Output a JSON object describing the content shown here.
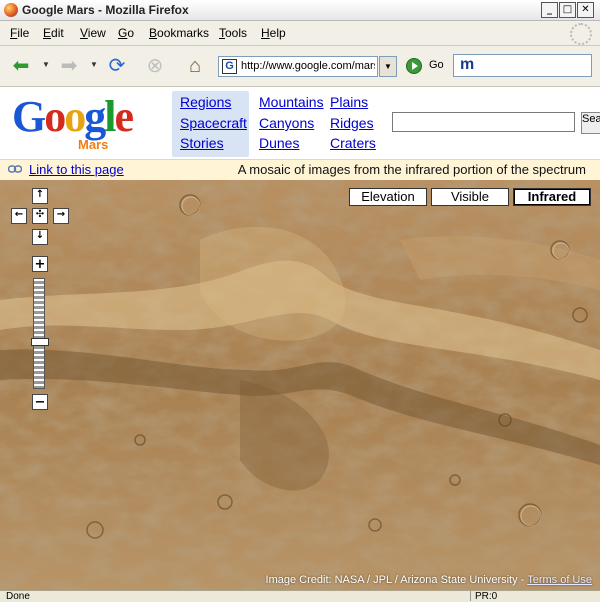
{
  "window": {
    "title": "Google Mars - Mozilla Firefox"
  },
  "menu": [
    {
      "mnemonic": "F",
      "rest": "ile"
    },
    {
      "mnemonic": "E",
      "rest": "dit"
    },
    {
      "mnemonic": "V",
      "rest": "iew"
    },
    {
      "mnemonic": "G",
      "rest": "o"
    },
    {
      "mnemonic": "B",
      "rest": "ookmarks"
    },
    {
      "mnemonic": "T",
      "rest": "ools"
    },
    {
      "mnemonic": "H",
      "rest": "elp"
    }
  ],
  "toolbar": {
    "url": "http://www.google.com/mars/",
    "go_label": "Go",
    "search_prefix": "m"
  },
  "header": {
    "logo": [
      "G",
      "o",
      "o",
      "g",
      "l",
      "e"
    ],
    "logo_sub": "Mars",
    "categories": {
      "col1": [
        "Regions",
        "Spacecraft",
        "Stories"
      ],
      "col2": [
        "Mountains",
        "Canyons",
        "Dunes"
      ],
      "col3": [
        "Plains",
        "Ridges",
        "Craters"
      ]
    },
    "search_value": "",
    "search_button": "Search"
  },
  "infobar": {
    "link_label": "Link to this page",
    "caption": "A mosaic of images from the infrared portion of the spectrum"
  },
  "map": {
    "modes": [
      {
        "label": "Elevation",
        "active": false
      },
      {
        "label": "Visible",
        "active": false
      },
      {
        "label": "Infrared",
        "active": true
      }
    ],
    "credit": "Image Credit: NASA / JPL / Arizona State University -",
    "terms": "Terms of Use",
    "colors": {
      "surface": "#b08a58",
      "dark": "#7a5a34",
      "light": "#e6c99a"
    }
  },
  "status": {
    "text": "Done",
    "pr": "PR:0"
  }
}
